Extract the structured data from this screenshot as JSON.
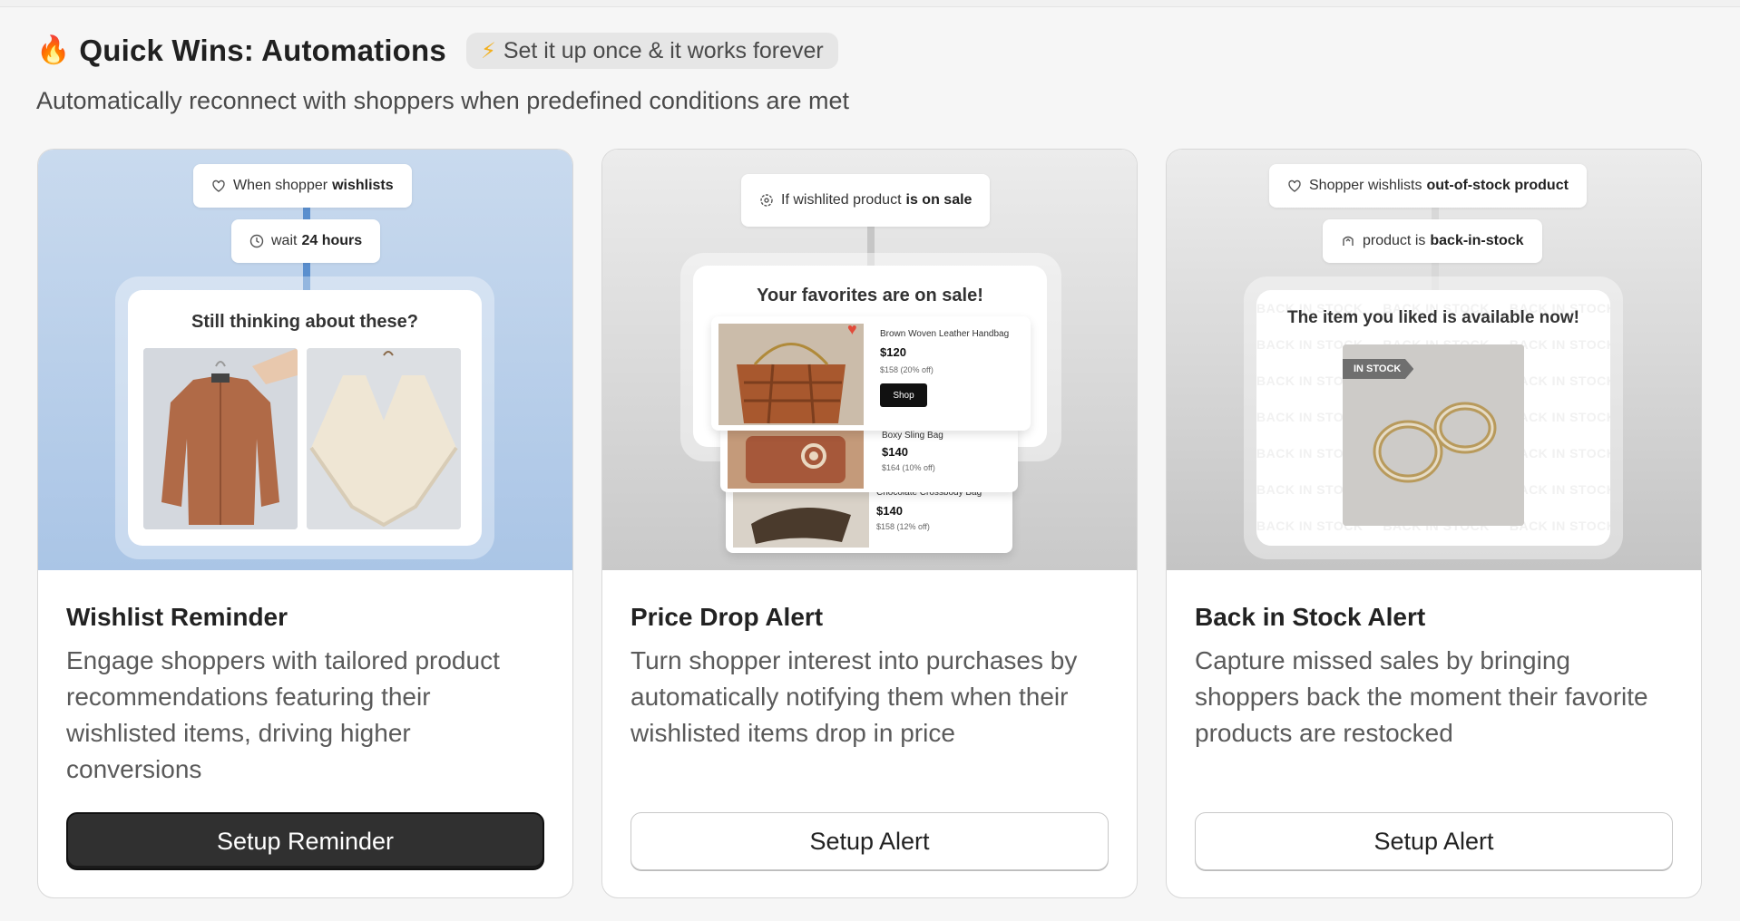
{
  "header": {
    "emoji": "🔥",
    "title": "Quick Wins: Automations",
    "pill_icon": "⚡",
    "pill_text": "Set it up once & it works forever",
    "subtitle": "Automatically reconnect with shoppers when predefined conditions are met"
  },
  "cards": [
    {
      "title": "Wishlist Reminder",
      "description": "Engage shoppers with tailored product recommendations featuring their wishlisted items, driving higher conversions",
      "button": "Setup Reminder",
      "button_style": "primary",
      "media": {
        "step1_prefix": "When shopper",
        "step1_bold": "wishlists",
        "step1_icon": "heart-icon",
        "step2_prefix": "wait",
        "step2_bold": "24 hours",
        "step2_icon": "clock-icon",
        "preview_title": "Still thinking about these?",
        "accent": "#5a8fce"
      }
    },
    {
      "title": "Price Drop Alert",
      "description": "Turn shopper interest into purchases by automatically notifying them when their wishlisted items drop in price",
      "button": "Setup Alert",
      "button_style": "secondary",
      "media": {
        "step1_prefix": "If wishlited product",
        "step1_bold": "is on sale",
        "step1_icon": "gear-badge-icon",
        "preview_title": "Your favorites are on sale!",
        "products": [
          {
            "name": "Brown Woven Leather Handbag",
            "price": "$120",
            "old": "$158 (20% off)",
            "cta": "Shop"
          },
          {
            "name": "Boxy Sling Bag",
            "price": "$140",
            "old": "$164 (10% off)"
          },
          {
            "name": "Chocolate Crossbody Bag",
            "price": "$140",
            "old": "$158 (12% off)"
          }
        ]
      }
    },
    {
      "title": "Back in Stock Alert",
      "description": "Capture missed sales by bringing shoppers back the moment their favorite products are restocked",
      "button": "Setup Alert",
      "button_style": "secondary",
      "media": {
        "step1_prefix": "Shopper wishlists",
        "step1_bold": "out-of-stock product",
        "step1_icon": "heart-icon",
        "step2_prefix": "product is",
        "step2_bold": "back-in-stock",
        "step2_icon": "arrow-up-icon",
        "preview_title": "The item you liked is available now!",
        "badge": "IN STOCK",
        "watermark": "BACK IN STOCK"
      }
    }
  ]
}
